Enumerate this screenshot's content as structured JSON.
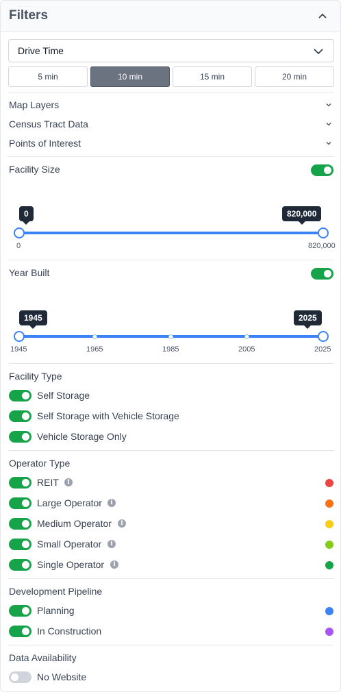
{
  "header": {
    "title": "Filters",
    "collapse_icon": "chevron-up-icon"
  },
  "drive_time": {
    "selected_label": "Drive Time",
    "options": [
      "5 min",
      "10 min",
      "15 min",
      "20 min"
    ],
    "active_option": "10 min"
  },
  "layers": [
    "Map Layers",
    "Census Tract Data",
    "Points of Interest"
  ],
  "facility_size": {
    "title": "Facility Size",
    "enabled": true,
    "min_value_label": "0",
    "max_value_label": "820,000",
    "axis_min": "0",
    "axis_max": "820,000"
  },
  "year_built": {
    "title": "Year Built",
    "enabled": true,
    "min_value_label": "1945",
    "max_value_label": "2025",
    "ticks": [
      "1945",
      "1965",
      "1985",
      "2005",
      "2025"
    ]
  },
  "facility_type": {
    "title": "Facility Type",
    "items": [
      {
        "label": "Self Storage",
        "enabled": true
      },
      {
        "label": "Self Storage with Vehicle Storage",
        "enabled": true
      },
      {
        "label": "Vehicle Storage Only",
        "enabled": true
      }
    ]
  },
  "operator_type": {
    "title": "Operator Type",
    "items": [
      {
        "label": "REIT",
        "enabled": true,
        "color": "#ef4444"
      },
      {
        "label": "Large Operator",
        "enabled": true,
        "color": "#f97316"
      },
      {
        "label": "Medium Operator",
        "enabled": true,
        "color": "#facc15"
      },
      {
        "label": "Small Operator",
        "enabled": true,
        "color": "#84cc16"
      },
      {
        "label": "Single Operator",
        "enabled": true,
        "color": "#16a34a"
      }
    ]
  },
  "development_pipeline": {
    "title": "Development Pipeline",
    "items": [
      {
        "label": "Planning",
        "enabled": true,
        "color": "#3b82f6"
      },
      {
        "label": "In Construction",
        "enabled": true,
        "color": "#a855f7"
      }
    ]
  },
  "data_availability": {
    "title": "Data Availability",
    "items": [
      {
        "label": "No Website",
        "enabled": false
      }
    ]
  },
  "colors": {
    "toggle_on": "#16a34a",
    "slider": "#3b82f6",
    "active_segment": "#6b7280"
  }
}
